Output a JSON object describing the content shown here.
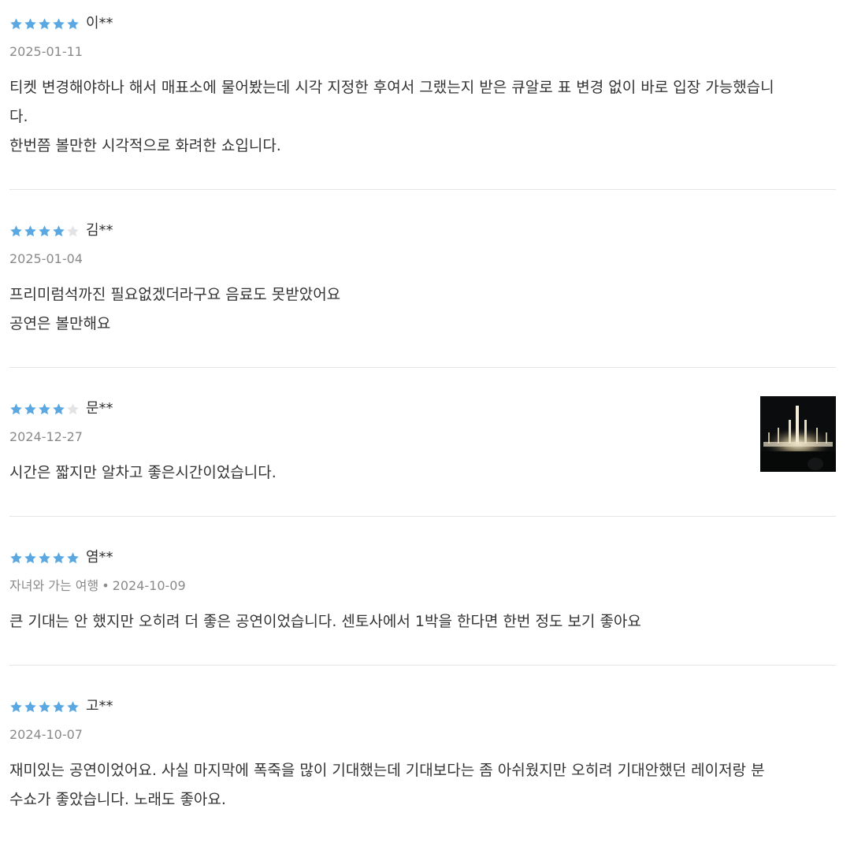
{
  "colors": {
    "star_on": "#5aa8e3",
    "star_off": "#e3e3e6"
  },
  "reviews": [
    {
      "rating": 5,
      "author": "이**",
      "date": "2025-01-11",
      "trip_type": "",
      "lines": [
        "티켓 변경해야하나 해서 매표소에 물어봤는데 시각 지정한 후여서 그랬는지 받은 큐알로 표 변경 없이 바로 입장 가능했습니",
        "다.",
        "한번쯤 볼만한 시각적으로 화려한 쇼입니다."
      ],
      "has_photo": false
    },
    {
      "rating": 4,
      "author": "김**",
      "date": "2025-01-04",
      "trip_type": "",
      "lines": [
        "프리미럼석까진 필요없겠더라구요 음료도 못받았어요",
        "공연은 볼만해요"
      ],
      "has_photo": false
    },
    {
      "rating": 4,
      "author": "문**",
      "date": "2024-12-27",
      "trip_type": "",
      "lines": [
        "시간은 짧지만 알차고 좋은시간이었습니다."
      ],
      "has_photo": true
    },
    {
      "rating": 5,
      "author": "염**",
      "date": "2024-10-09",
      "trip_type": "자녀와 가는 여행",
      "separator": "•",
      "lines": [
        "큰 기대는 안 했지만 오히려 더 좋은 공연이었습니다. 센토사에서 1박을 한다면 한번 정도 보기 좋아요"
      ],
      "has_photo": false
    },
    {
      "rating": 5,
      "author": "고**",
      "date": "2024-10-07",
      "trip_type": "",
      "lines": [
        "재미있는 공연이었어요. 사실 마지막에 폭죽을 많이 기대했는데 기대보다는 좀 아쉬웠지만 오히려 기대안했던 레이저랑 분",
        "수쇼가 좋았습니다. 노래도 좋아요."
      ],
      "has_photo": false
    }
  ]
}
